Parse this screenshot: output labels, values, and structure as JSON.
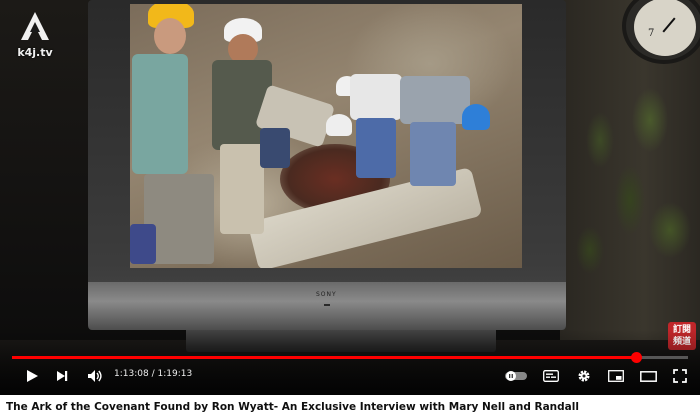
{
  "channel": {
    "logo_text": "k4j.tv",
    "watermark_text": "訂閱\n頻道"
  },
  "player": {
    "current_time": "1:13:08",
    "duration": "1:19:13",
    "progress_fraction": 0.923,
    "accent_color": "#ff0000",
    "controls": {
      "play_icon": "play-icon",
      "next_icon": "next-icon",
      "volume_icon": "volume-icon",
      "autoplay_icon": "autoplay-toggle-icon",
      "subtitles_icon": "subtitles-icon",
      "settings_icon": "gear-icon",
      "miniplayer_icon": "miniplayer-icon",
      "theater_icon": "theater-mode-icon",
      "fullscreen_icon": "fullscreen-icon"
    },
    "tv_brand": "SONY"
  },
  "clock": {
    "visible_number": "7"
  },
  "video": {
    "title": "The Ark of the Covenant Found by Ron Wyatt- An Exclusive Interview with Mary Nell and Randall"
  }
}
